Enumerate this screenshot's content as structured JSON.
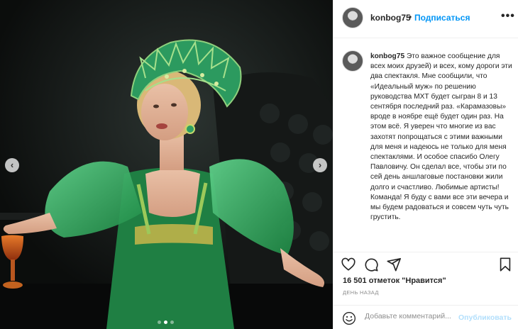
{
  "post": {
    "username": "konbog75",
    "separator": "•",
    "follow_label": "Подписаться",
    "more_label": "•••",
    "caption_user": "konbog75",
    "caption_text": "Это важное сообщение для всех моих друзей) и всех, кому дороги эти два спектакля. Мне сообщили, что «Идеальный муж» по решению руководства МХТ будет сыгран 8 и 13 сентября последний раз. «Карамазовы» вроде в ноябре ещё будет один раз. На этом всё. Я уверен что многие из вас захотят попрощаться с этими важными для меня и надеюсь не только для меня спектаклями. И особое спасибо Олегу Павловичу. Он сделал все, чтобы эти по сей день аншлаговые постановки жили долго и счастливо. Любимые артисты! Команда! Я буду с вами все эти вечера и мы будем радоваться и совсем чуть чуть грустить.",
    "likes": "16 501 отметок \"Нравится\"",
    "timestamp": "ДЕНЬ НАЗАД",
    "comment_placeholder": "Добавьте комментарий...",
    "publish_label": "Опубликовать"
  },
  "carousel": {
    "prev_icon": "chevron-left-icon",
    "next_icon": "chevron-right-icon",
    "prev_glyph": "‹",
    "next_glyph": "›",
    "slide_count": 3,
    "active_index": 1
  },
  "actions": {
    "icons": [
      "heart-icon",
      "comment-icon",
      "share-icon",
      "bookmark-icon"
    ]
  },
  "colors": {
    "link": "#0095f6",
    "publish_disabled": "#b2dffc",
    "dress": "#2fa35a"
  }
}
